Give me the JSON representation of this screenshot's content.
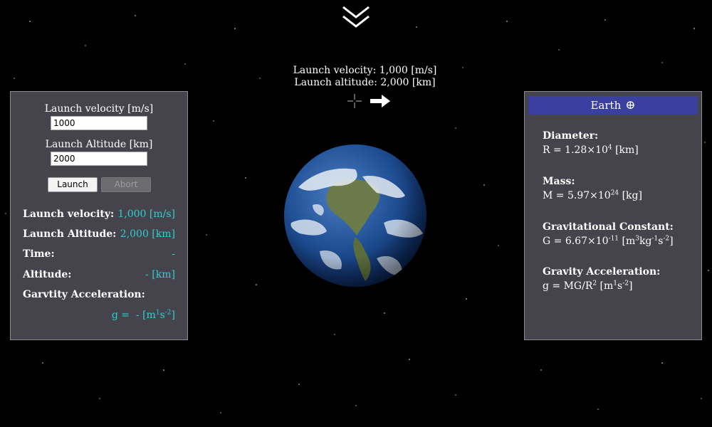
{
  "hud": {
    "velocity_text": "Launch velocity: 1,000 [m/s]",
    "altitude_text": "Launch altitude: 2,000 [km]"
  },
  "controls": {
    "velocity_label": "Launch velocity [m/s]",
    "velocity_value": "1000",
    "altitude_label": "Launch Altitude [km]",
    "altitude_value": "2000",
    "launch_button": "Launch",
    "abort_button": "Abort"
  },
  "stats": {
    "velocity_label": "Launch velocity:",
    "velocity_value": "1,000 [m/s]",
    "altitude_label": "Launch Altitude:",
    "altitude_value": "2,000 [km]",
    "time_label": "Time:",
    "time_value": "-",
    "current_altitude_label": "Altitude:",
    "current_altitude_value": "- [km]",
    "gravity_label": "Garvtity Acceleration:",
    "gravity_prefix": "g =",
    "gravity_value": "- [m",
    "gravity_exp1": "1",
    "gravity_unit2": "s",
    "gravity_exp2": "-2",
    "gravity_close": "]"
  },
  "planet": {
    "name": "Earth",
    "symbol": "⊕",
    "diameter_title": "Diameter:",
    "diameter_base": "R = 1.28×10",
    "diameter_exp": "4",
    "diameter_unit": " [km]",
    "mass_title": "Mass:",
    "mass_base": "M = 5.97×10",
    "mass_exp": "24",
    "mass_unit": " [kg]",
    "gconst_title": "Gravitational Constant:",
    "gconst_base": "G = 6.67×10",
    "gconst_exp": "-11",
    "gconst_unit_a": " [m",
    "gconst_exp_m": "3",
    "gconst_unit_b": "kg",
    "gconst_exp_kg": "-1",
    "gconst_unit_c": "s",
    "gconst_exp_s": "-2",
    "gconst_close": "]",
    "gacc_title": "Gravity Acceleration:",
    "gacc_base": "g = MG/R",
    "gacc_exp": "2",
    "gacc_unit_a": " [m",
    "gacc_exp_m": "1",
    "gacc_unit_b": "s",
    "gacc_exp_s": "-2",
    "gacc_close": "]"
  },
  "colors": {
    "panel_bg": "#45444c",
    "accent_cyan": "#2ecfd0",
    "header_blue": "#3a3fa0"
  },
  "icons": {
    "collapse": "chevron-double-down-icon",
    "target": "crosshair-icon",
    "direction": "arrow-right-icon"
  }
}
